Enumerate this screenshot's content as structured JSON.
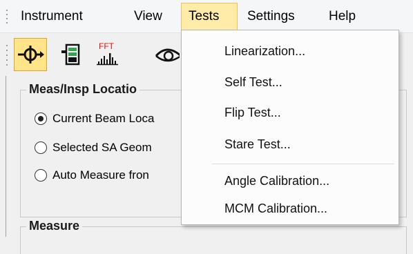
{
  "menubar": {
    "items": [
      {
        "label": "Instrument"
      },
      {
        "label": "View"
      },
      {
        "label": "Tests"
      },
      {
        "label": "Settings"
      },
      {
        "label": "Help"
      }
    ],
    "active": "Tests"
  },
  "toolbar": {
    "fft_label": "FFT",
    "tools": [
      "target-icon",
      "battery-icon",
      "fft-spectrum-icon",
      "eye-icon"
    ]
  },
  "panel": {
    "meas_group_title": "Meas/Insp Locatio",
    "options": [
      {
        "label": "Current Beam Loca",
        "checked": true
      },
      {
        "label": "Selected SA Geom",
        "checked": false
      },
      {
        "label": "Auto Measure fron",
        "checked": false
      }
    ],
    "measure_group_title": "Measure"
  },
  "tests_menu": {
    "items": [
      {
        "label": "Linearization..."
      },
      {
        "label": "Self Test..."
      },
      {
        "label": "Flip Test..."
      },
      {
        "label": "Stare Test..."
      },
      {
        "label": "Angle Calibration..."
      },
      {
        "label": "MCM Calibration..."
      }
    ]
  },
  "colors": {
    "active_menu_bg": "#ffeca8",
    "pressed_tool_bg": "#ffe48a",
    "fft_red": "#e01010",
    "battery_green": "#2fa84f"
  }
}
